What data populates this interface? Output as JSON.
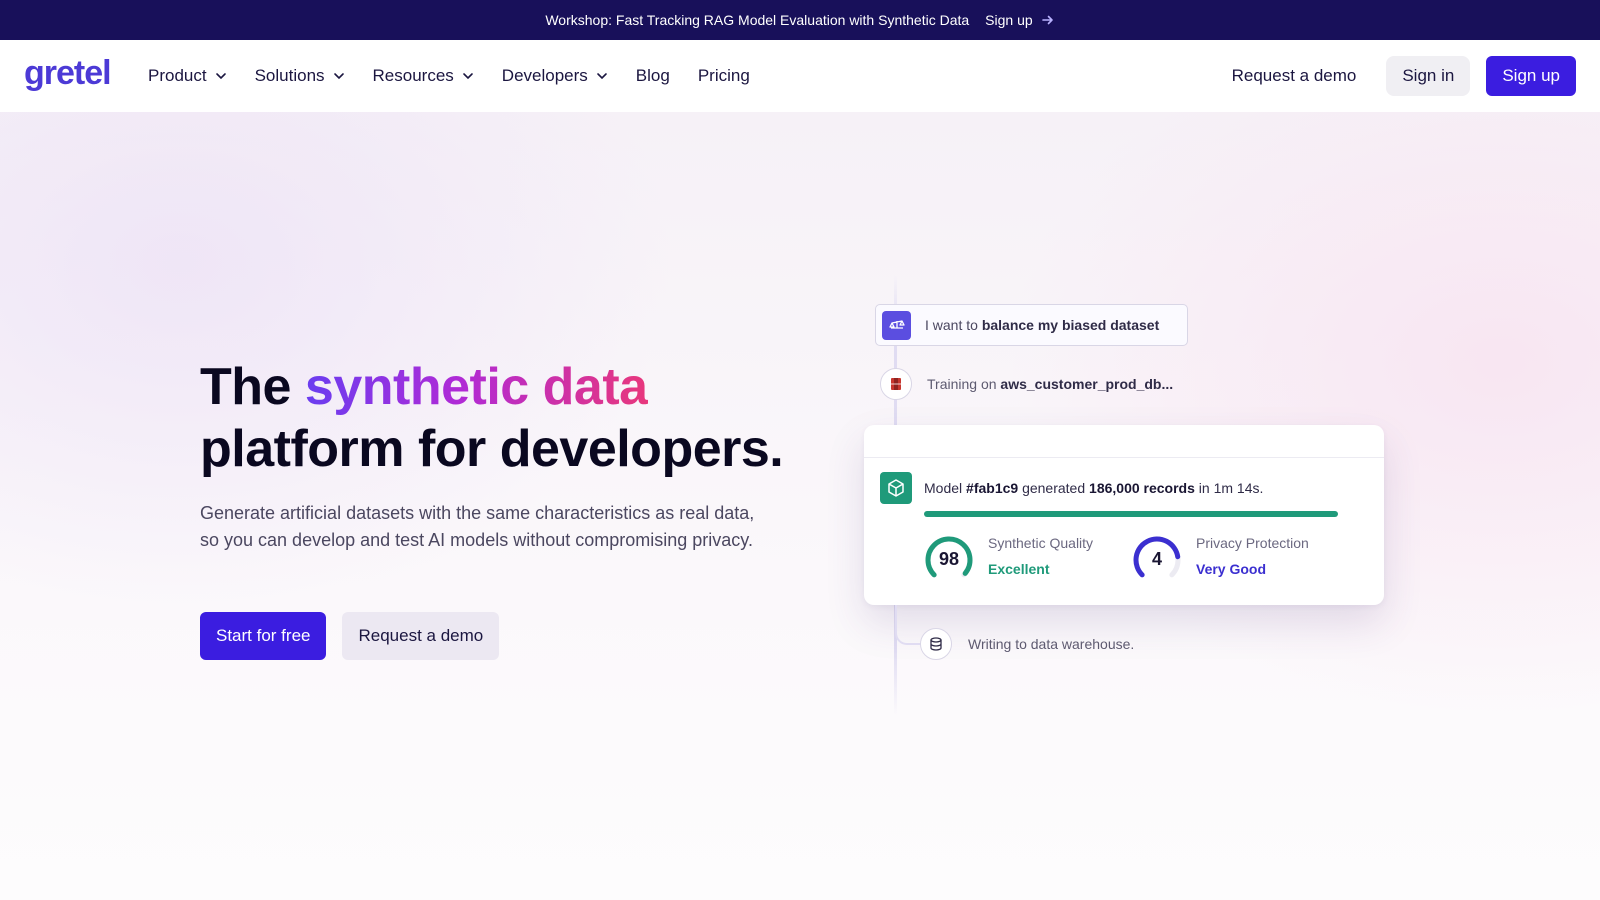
{
  "announcement": {
    "text": "Workshop: Fast Tracking RAG Model Evaluation with Synthetic Data",
    "link_label": "Sign up"
  },
  "header": {
    "logo": "gretel",
    "nav": [
      {
        "label": "Product",
        "has_dropdown": true
      },
      {
        "label": "Solutions",
        "has_dropdown": true
      },
      {
        "label": "Resources",
        "has_dropdown": true
      },
      {
        "label": "Developers",
        "has_dropdown": true
      },
      {
        "label": "Blog",
        "has_dropdown": false
      },
      {
        "label": "Pricing",
        "has_dropdown": false
      }
    ],
    "request_demo": "Request a demo",
    "sign_in": "Sign in",
    "sign_up": "Sign up"
  },
  "hero": {
    "title_prefix": "The ",
    "title_highlight": "synthetic data",
    "title_suffix": "platform for developers.",
    "subtitle": "Generate artificial datasets with the same characteristics as real data, so you can develop and test AI models without compromising privacy.",
    "cta_primary": "Start for free",
    "cta_secondary": "Request a demo"
  },
  "demo": {
    "task_prefix": "I want to ",
    "task_bold": "balance my biased dataset",
    "training_prefix": "Training on ",
    "training_bold": "aws_customer_prod_db...",
    "card": {
      "model_prefix": "Model ",
      "model_id": "#fab1c9",
      "generated_text": " generated ",
      "records": "186,000 records",
      "time_text": " in 1m 14s.",
      "progress": 1.0,
      "metrics": [
        {
          "score": "98",
          "label": "Synthetic Quality",
          "status": "Excellent",
          "color": "#1f9a7a",
          "fraction": 0.98
        },
        {
          "score": "4",
          "label": "Privacy Protection",
          "status": "Very Good",
          "color": "#3b2fd0",
          "fraction": 0.8
        }
      ]
    },
    "writing": "Writing to data warehouse."
  },
  "colors": {
    "brand": "#3b1de0",
    "announcement_bg": "#18105a",
    "success": "#1f9a7a",
    "privacy": "#3b2fd0"
  },
  "icons": {
    "arrow": "arrow-right-icon",
    "chevron": "chevron-down-icon",
    "task": "balance-scale-icon",
    "training": "aws-database-icon",
    "model": "cube-icon",
    "writing": "database-icon"
  }
}
